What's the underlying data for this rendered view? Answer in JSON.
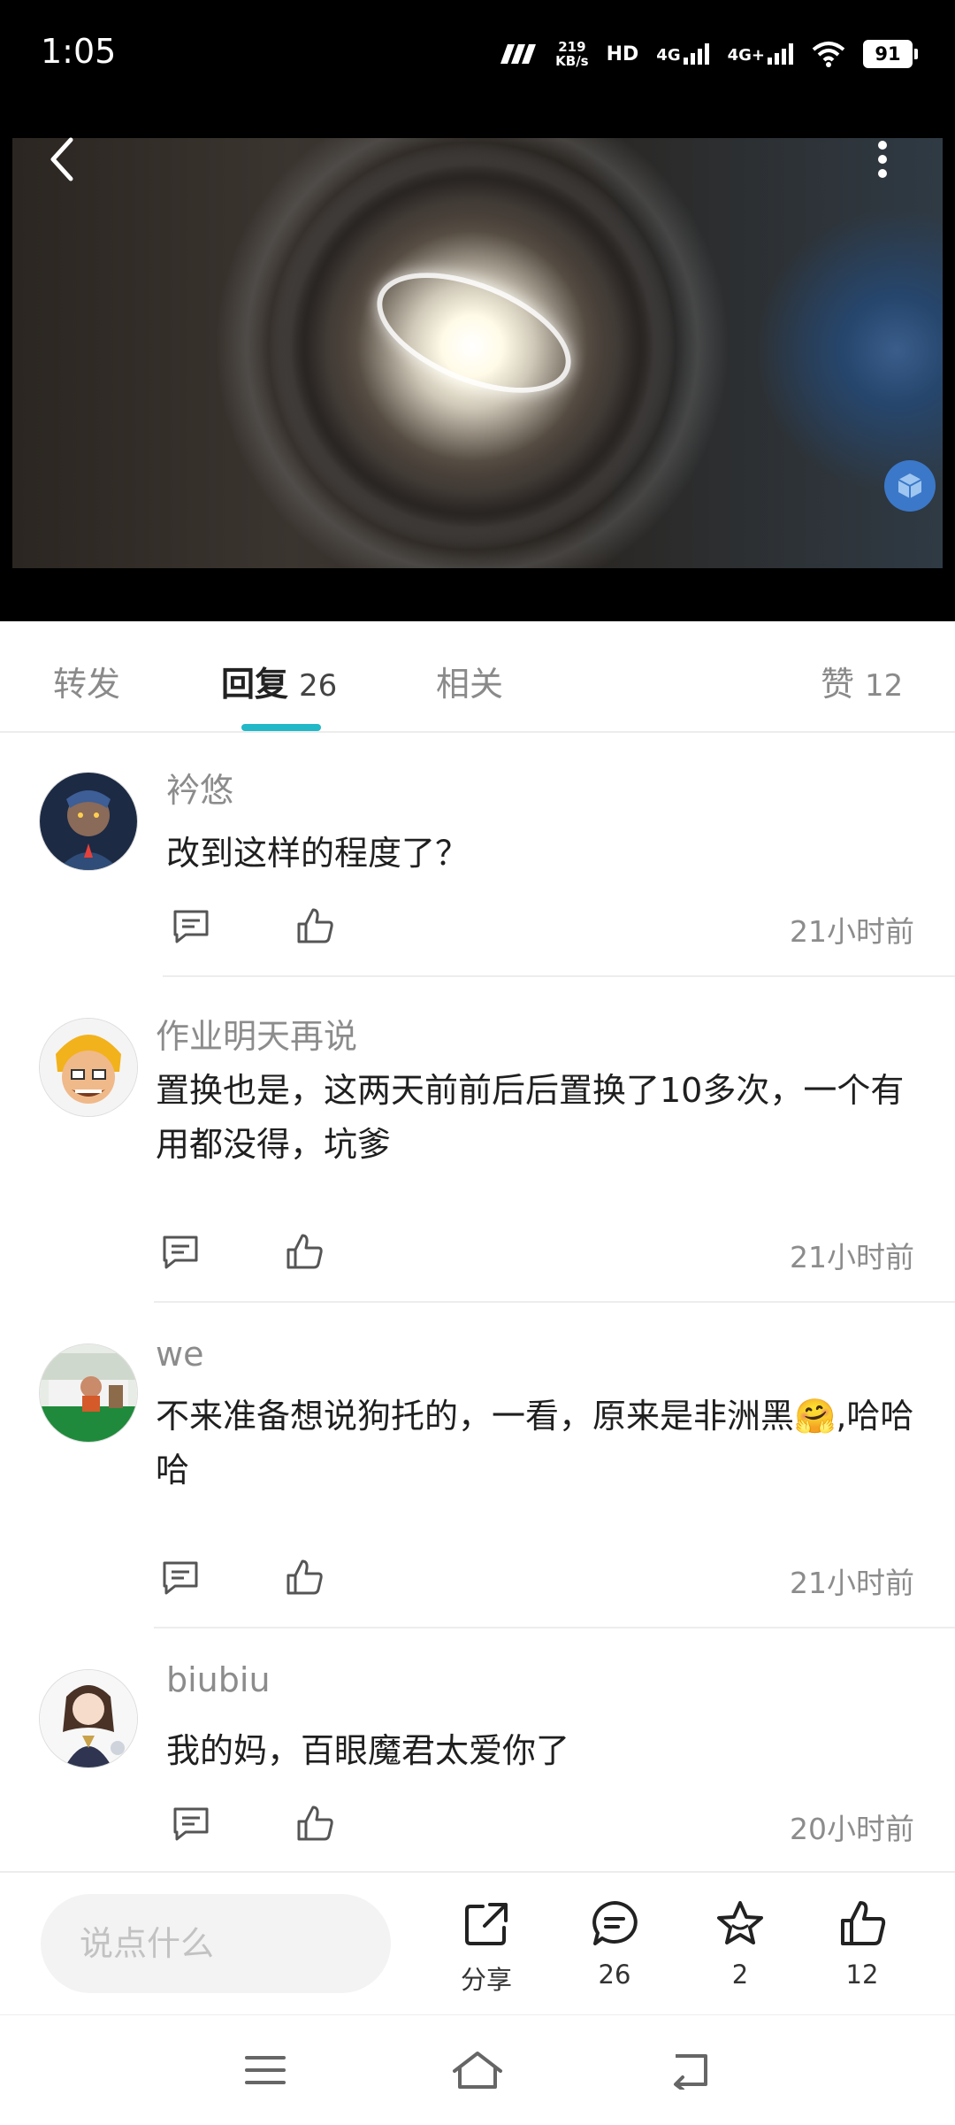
{
  "status_bar": {
    "time": "1:05",
    "net_speed_value": "219",
    "net_speed_unit": "KB/s",
    "hd_label": "HD",
    "sim1_label": "4G",
    "sim2_label": "4G+",
    "battery": "91"
  },
  "tabs": {
    "forward": "转发",
    "reply": "回复",
    "reply_count": "26",
    "related": "相关",
    "likes": "赞",
    "likes_count": "12"
  },
  "comments": [
    {
      "name": "衿悠",
      "text": "改到这样的程度了？",
      "time": "21小时前"
    },
    {
      "name": "作业明天再说",
      "text": "置换也是，这两天前前后后置换了10多次，一个有用都没得，坑爹",
      "time": "21小时前"
    },
    {
      "name": "we",
      "text": "不来准备想说狗托的，一看，原来是非洲黑🤗,哈哈哈",
      "time": "21小时前"
    },
    {
      "name": "biubiu",
      "text": "我的妈，百眼魔君太爱你了",
      "time": "20小时前"
    }
  ],
  "action_bar": {
    "input_placeholder": "说点什么",
    "share_label": "分享",
    "comment_count": "26",
    "favorite_count": "2",
    "like_count": "12"
  },
  "colors": {
    "accent": "#22b8c7",
    "status_bar_bg": "#000000",
    "secondary_text": "#8c8c8c"
  }
}
